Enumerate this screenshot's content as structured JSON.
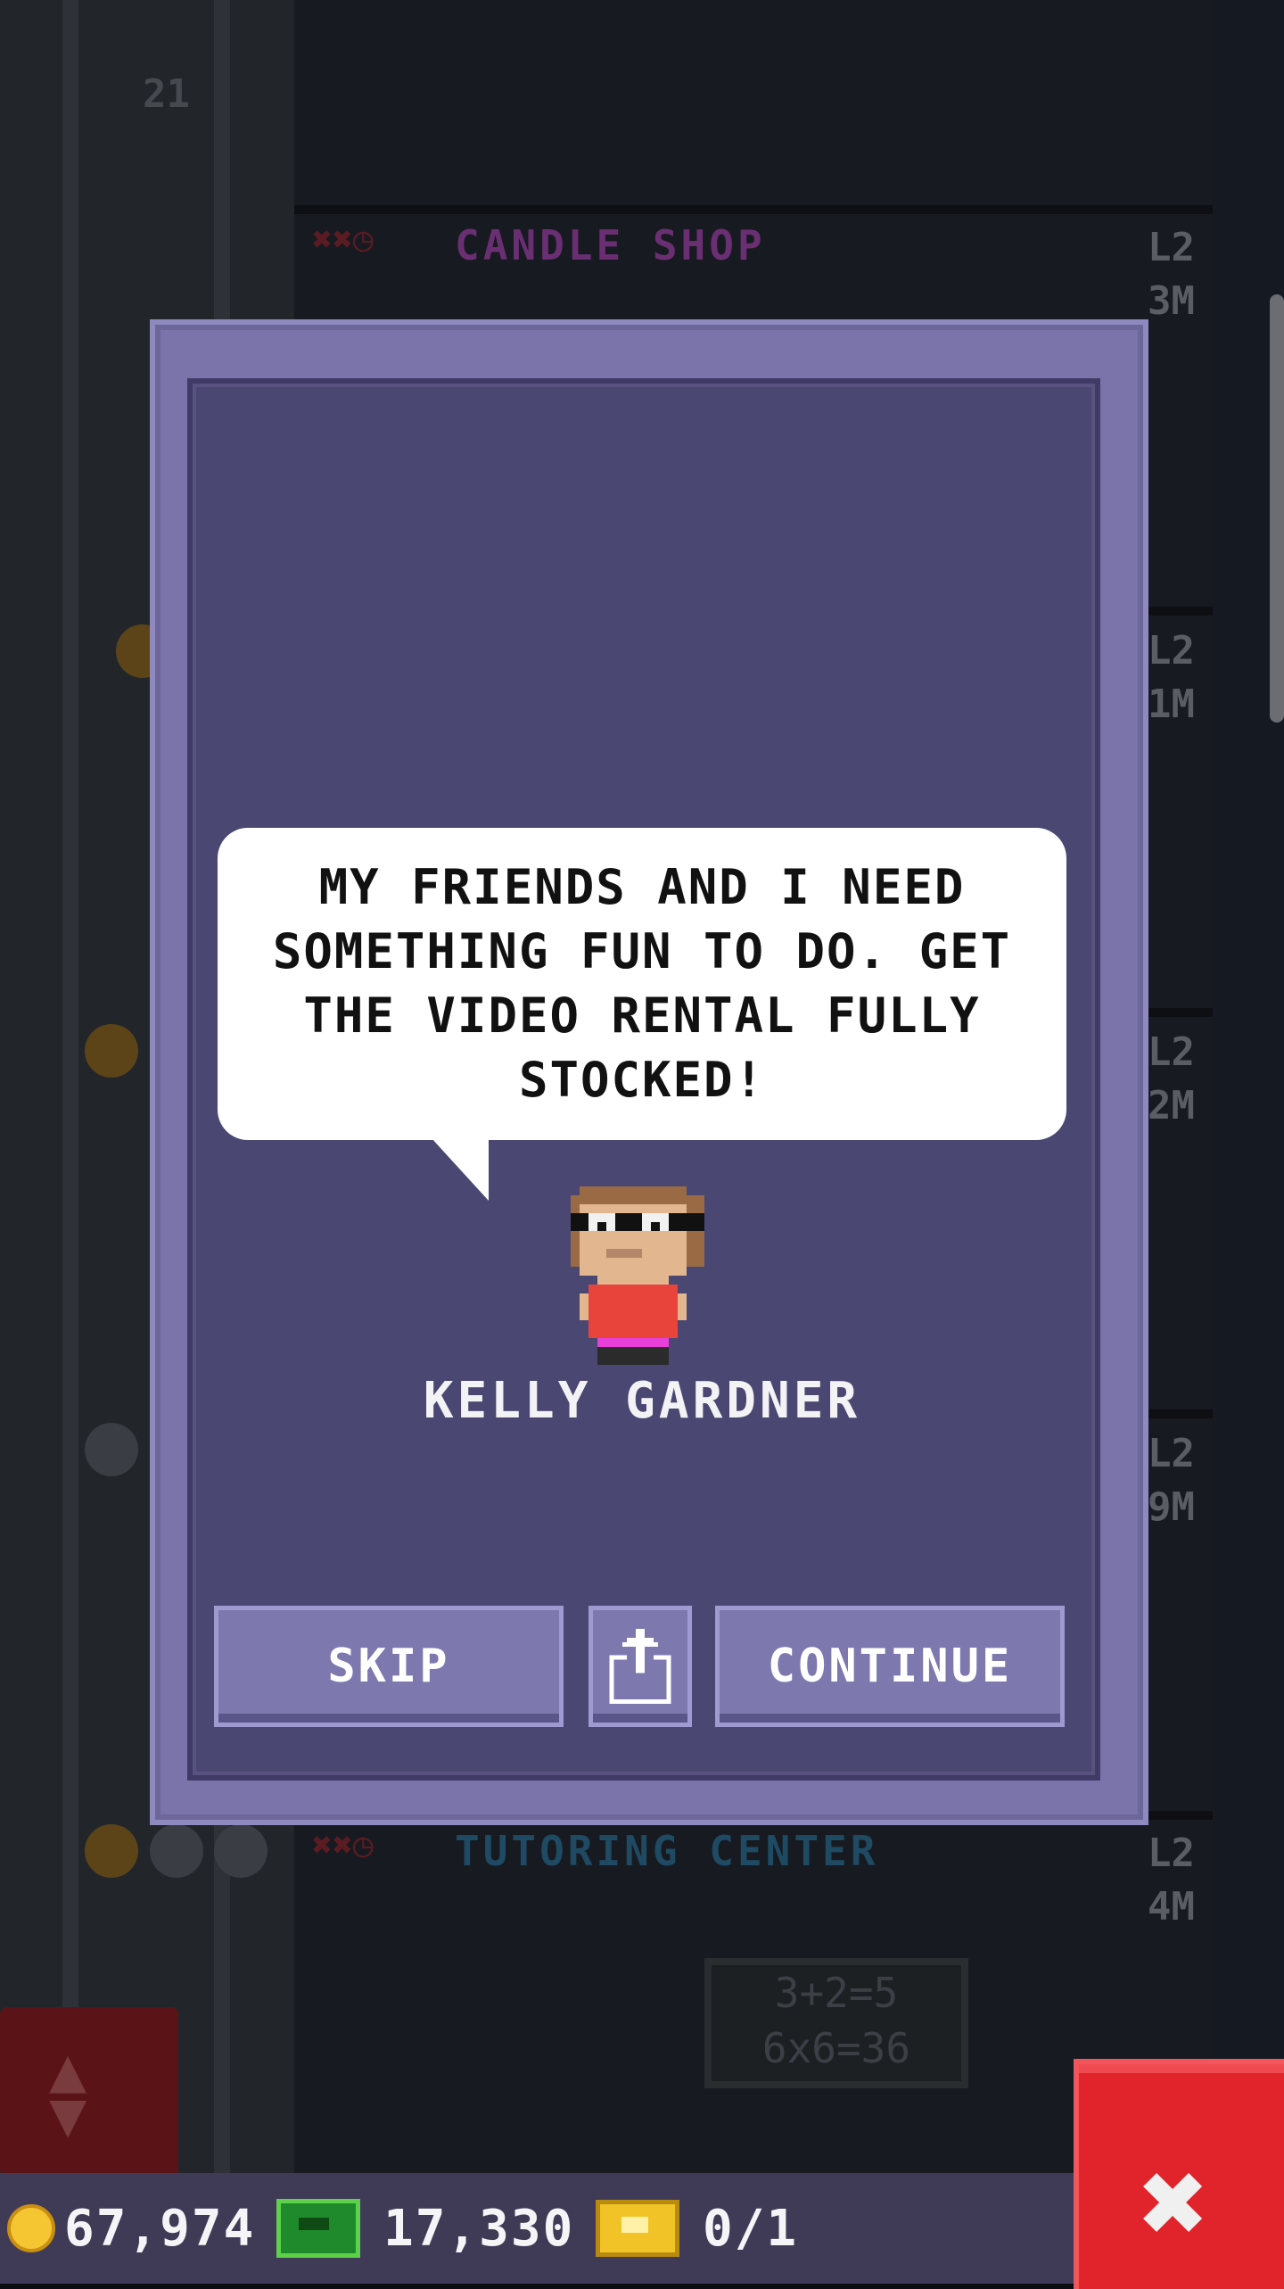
{
  "background": {
    "floors": [
      {
        "label": "",
        "level": "",
        "cost": ""
      },
      {
        "label": "CANDLE SHOP",
        "level": "L2",
        "cost": "3M",
        "label_color": "#6a2f73"
      },
      {
        "label": "",
        "level": "L2",
        "cost": "1M"
      },
      {
        "label": "",
        "level": "L2",
        "cost": "2M"
      },
      {
        "label": "",
        "level": "L2",
        "cost": "9M"
      },
      {
        "label": "TUTORING CENTER",
        "level": "L2",
        "cost": "4M",
        "label_color": "#1f4a63"
      }
    ],
    "floor_number": "21",
    "chalkboard": [
      "3+2=5",
      "6x6=36"
    ],
    "floor_status_icons": "✖✖◷"
  },
  "dialog": {
    "message": "MY FRIENDS AND I NEED SOMETHING FUN TO DO. GET THE VIDEO RENTAL FULLY STOCKED!",
    "character_name": "KELLY GARDNER",
    "skip_label": "SKIP",
    "share_icon": "share-icon",
    "continue_label": "CONTINUE"
  },
  "hud": {
    "coins": "67,974",
    "bux": "17,330",
    "tickets": "0/1"
  },
  "colors": {
    "modal_frame": "#7a74ab",
    "modal_inner": "#4b4773",
    "button": "#7d78ae",
    "close_button": "#e1232b",
    "hud_bg": "#3f3b57"
  }
}
